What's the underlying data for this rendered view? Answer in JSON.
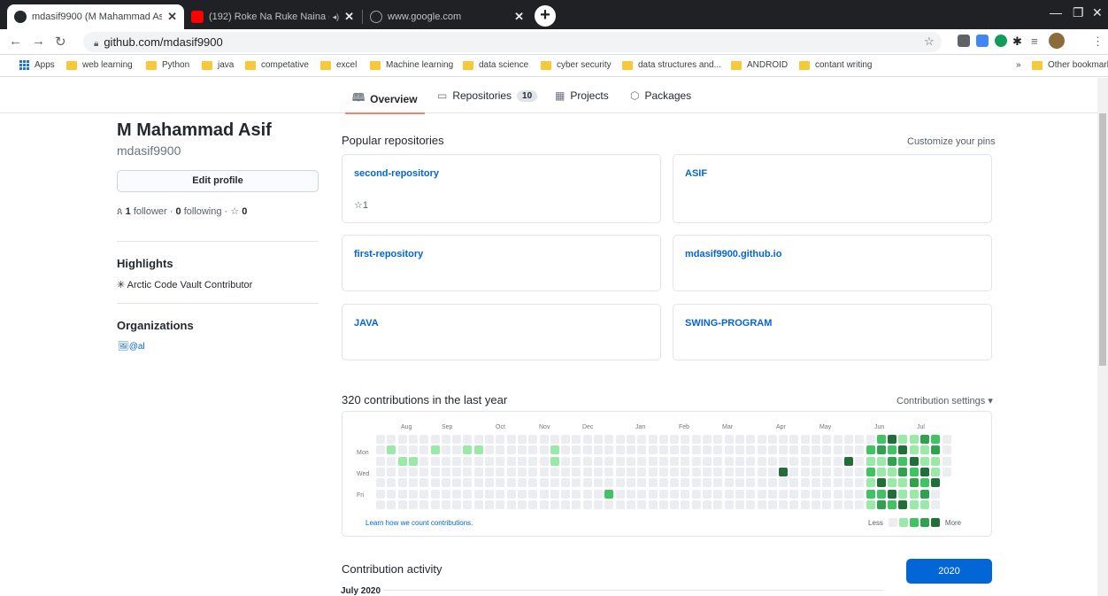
{
  "browser": {
    "tabs": [
      {
        "title": "mdasif9900 (M Mahammad Asif)",
        "active": true,
        "icon": "github-icon"
      },
      {
        "title": "(192) Roke Na Ruke Naina (F",
        "active": false,
        "icon": "youtube-icon",
        "audio": "speaker-icon"
      },
      {
        "title": "www.google.com",
        "active": false,
        "icon": "globe-icon"
      }
    ],
    "address": "github.com/mdasif9900",
    "bookmarks": [
      "Apps",
      "web learning",
      "Python",
      "java",
      "competative",
      "excel",
      "Machine learning",
      "data science",
      "cyber security",
      "data structures and...",
      "ANDROID",
      "contant writing"
    ],
    "other_bookmarks": "Other bookmarks",
    "overflow": "»"
  },
  "nav_tabs": [
    {
      "label": "Overview",
      "icon": "book-icon"
    },
    {
      "label": "Repositories",
      "count": "10",
      "icon": "repo-icon"
    },
    {
      "label": "Projects",
      "icon": "project-icon"
    },
    {
      "label": "Packages",
      "icon": "package-icon"
    }
  ],
  "profile": {
    "name": "M Mahammad Asif",
    "login": "mdasif9900",
    "edit_label": "Edit profile",
    "followers": "1",
    "followers_label": "follower",
    "following": "0",
    "following_label": "following",
    "stars": "0",
    "highlights_title": "Highlights",
    "achievement": "Arctic Code Vault Contributor",
    "orgs_title": "Organizations",
    "org_alt": "@al"
  },
  "popular": {
    "title": "Popular repositories",
    "customize": "Customize your pins",
    "repos": [
      {
        "name": "second-repository",
        "stars": "1"
      },
      {
        "name": "ASIF"
      },
      {
        "name": "first-repository"
      },
      {
        "name": "mdasif9900.github.io"
      },
      {
        "name": "JAVA"
      },
      {
        "name": "SWING-PROGRAM"
      }
    ]
  },
  "contributions": {
    "title": "320 contributions in the last year",
    "settings": "Contribution settings ▾",
    "months": [
      "Aug",
      "Sep",
      "Oct",
      "Nov",
      "Dec",
      "Jan",
      "Feb",
      "Mar",
      "Apr",
      "May",
      "Jun",
      "Jul"
    ],
    "day_labels": [
      "Mon",
      "Wed",
      "Fri"
    ],
    "learn": "Learn how we count contributions.",
    "less": "Less",
    "more": "More",
    "colors": [
      "#ebedf0",
      "#9be9a8",
      "#40c463",
      "#30a14e",
      "#216e39"
    ]
  },
  "activity": {
    "title": "Contribution activity",
    "year": "2020",
    "month": "July 2020"
  }
}
